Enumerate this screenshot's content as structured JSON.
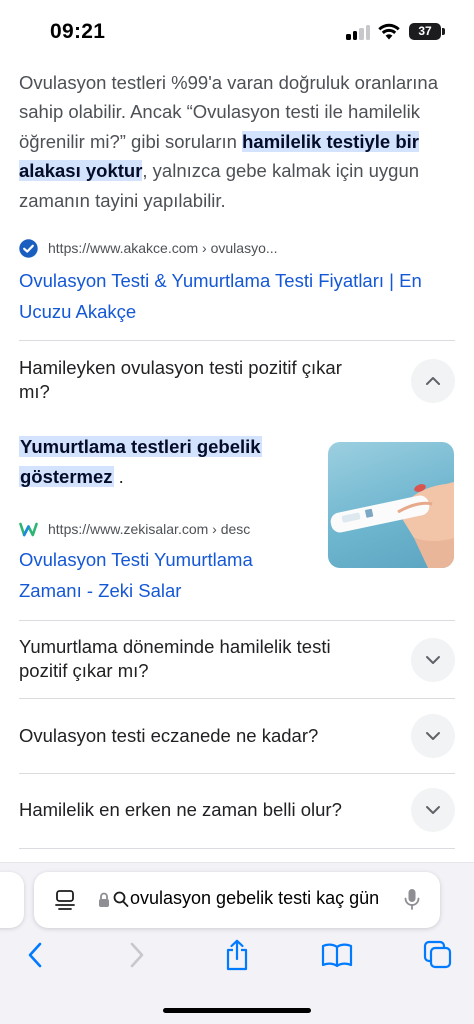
{
  "status": {
    "time": "09:21",
    "battery": "37"
  },
  "snippet": {
    "part1": "Ovulasyon testleri %99'a varan doğruluk oranlarına sahip olabilir. Ancak “Ovulasyon testi ile hamilelik öğrenilir mi?” gibi soruların ",
    "highlight": "hamilelik testiyle bir alakası yoktur",
    "part2": ", yalnızca gebe kalmak için uygun zamanın tayini yapılabilir."
  },
  "result1": {
    "url": "https://www.akakce.com › ovulasyo...",
    "title_line1": "Ovulasyon Testi & Yumurtlama Testi Fiyatları | En",
    "title_line2": "Ucuzu Akakçe"
  },
  "faq_expanded": {
    "question_line1": "Hamileyken ovulasyon testi pozitif çıkar",
    "question_line2": "mı?",
    "answer_line1": "Yumurtlama testleri gebelik",
    "answer_line2": "göstermez",
    "answer_suffix": " .",
    "source_url": "https://www.zekisalar.com › desc",
    "source_title_line1": "Ovulasyon Testi Yumurtlama",
    "source_title_line2": "Zamanı - Zeki Salar"
  },
  "faq_collapsed": [
    {
      "line1": "Yumurtlama döneminde hamilelik testi",
      "line2": "pozitif çıkar mı?"
    },
    {
      "line1": "Ovulasyon testi eczanede ne kadar?",
      "line2": ""
    },
    {
      "line1": "Hamilelik en erken ne zaman belli olur?",
      "line2": ""
    }
  ],
  "browser": {
    "address_text": "ovulasyon gebelik testi kaç gün"
  },
  "colors": {
    "link": "#1558d6",
    "highlight": "#d3e3fd",
    "ios_blue": "#007aff"
  },
  "icons": [
    "signal-icon",
    "wifi-icon",
    "verified-check-icon",
    "zekisalar-favicon",
    "chevron-up-icon",
    "chevron-down-icon",
    "tabs-format-icon",
    "lock-icon",
    "search-icon",
    "mic-icon",
    "back-arrow-icon",
    "forward-arrow-icon",
    "share-icon",
    "bookmarks-icon",
    "tabs-icon"
  ]
}
